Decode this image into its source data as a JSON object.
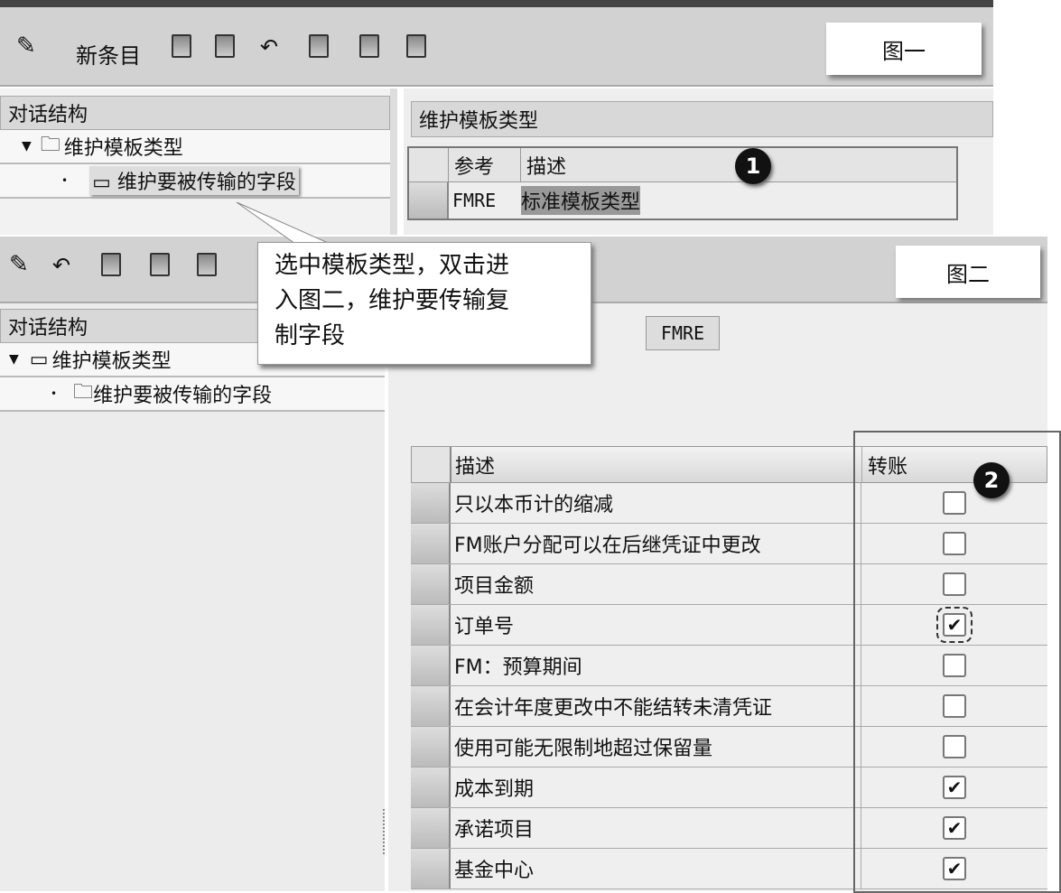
{
  "fig1": {
    "toolbar": {
      "new_entry": "新条目"
    },
    "label": "图一",
    "left_header": "对话结构",
    "tree": [
      "维护模板类型",
      "维护要被传输的字段"
    ],
    "right_header": "维护模板类型",
    "table": {
      "columns": [
        "参考",
        "描述"
      ],
      "rows": [
        {
          "ref": "FMRE",
          "desc": "标准模板类型"
        }
      ]
    },
    "marker": "1"
  },
  "callout": {
    "lines": [
      "选中模板类型，双击进",
      "入图二，维护要传输复",
      "制字段"
    ]
  },
  "fig2": {
    "label": "图二",
    "left_header": "对话结构",
    "tree": [
      "维护模板类型",
      "维护要被传输的字段"
    ],
    "field_value": "FMRE",
    "marker": "2",
    "table": {
      "columns": [
        "描述",
        "转账"
      ],
      "rows": [
        {
          "desc": "只以本币计的缩减",
          "checked": false
        },
        {
          "desc": "FM账户分配可以在后继凭证中更改",
          "checked": false
        },
        {
          "desc": "项目金额",
          "checked": false
        },
        {
          "desc": "订单号",
          "checked": true,
          "focused": true
        },
        {
          "desc": "FM：预算期间",
          "checked": false
        },
        {
          "desc": "在会计年度更改中不能结转未清凭证",
          "checked": false
        },
        {
          "desc": "使用可能无限制地超过保留量",
          "checked": false
        },
        {
          "desc": "成本到期",
          "checked": true
        },
        {
          "desc": "承诺项目",
          "checked": true
        },
        {
          "desc": "基金中心",
          "checked": true
        }
      ]
    }
  }
}
